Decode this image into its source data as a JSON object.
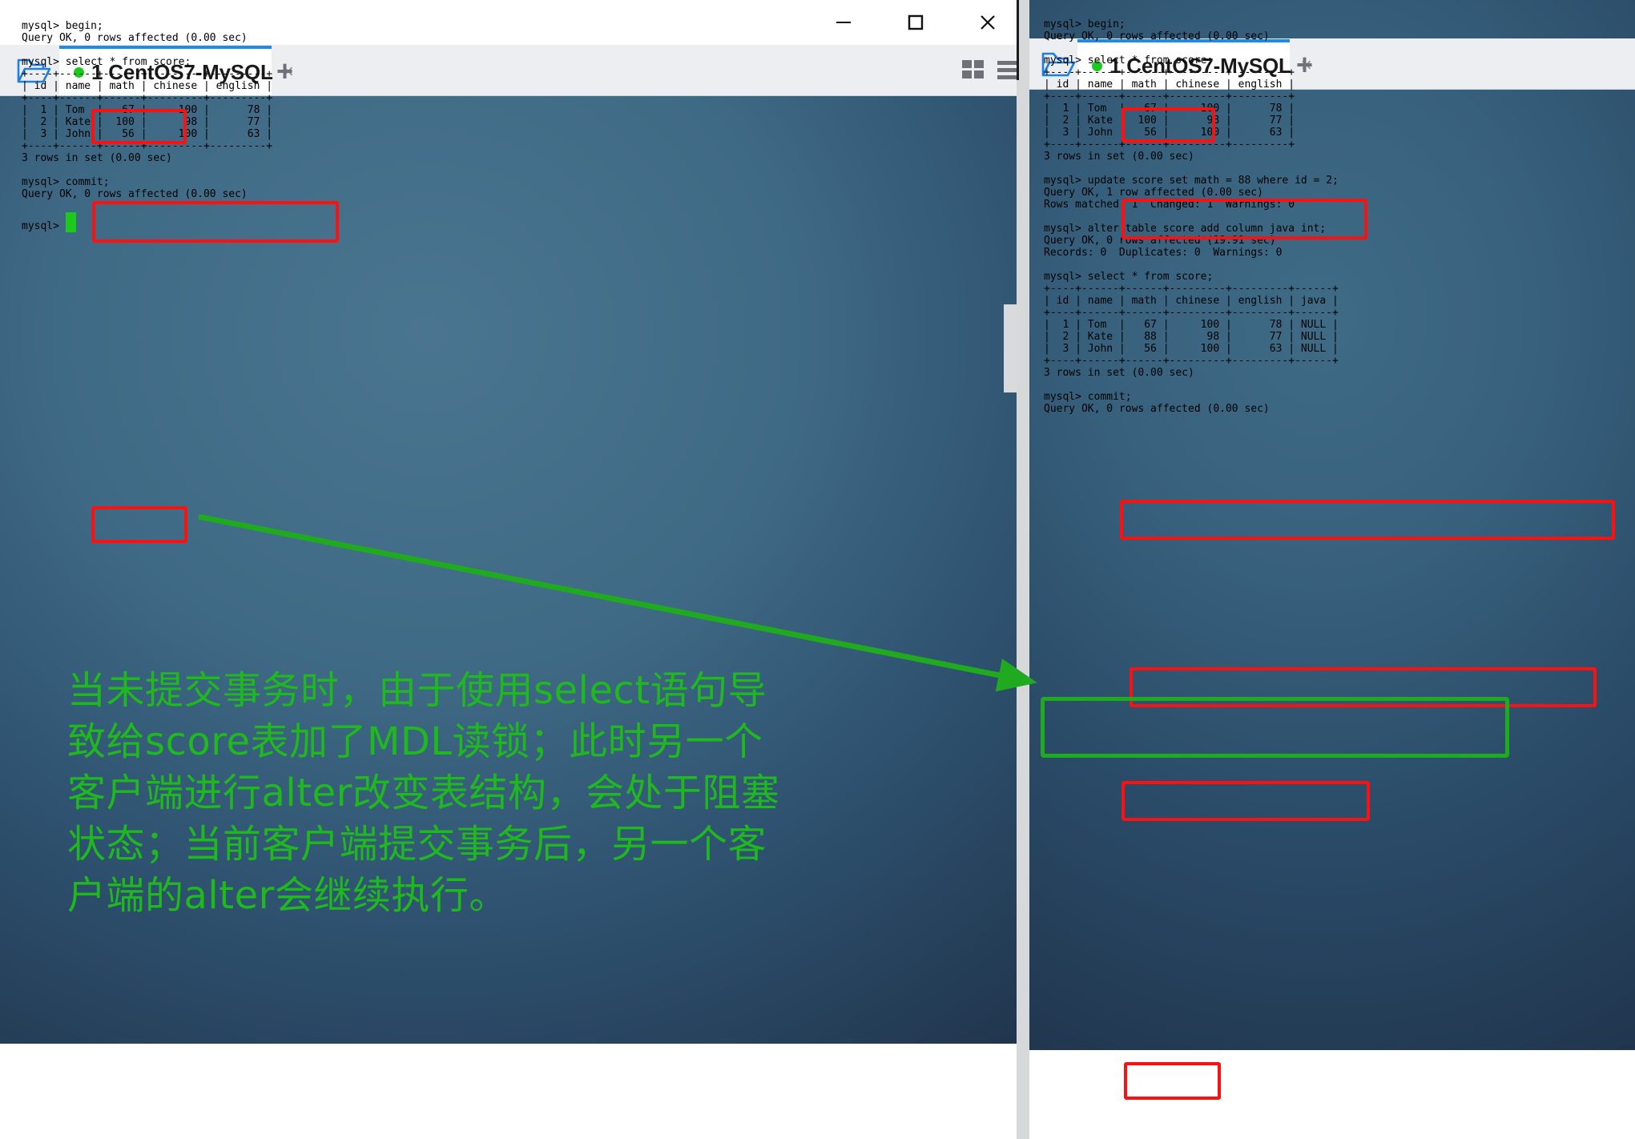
{
  "window": {
    "controls": {
      "minimize": "–",
      "maximize": "□",
      "close": "×"
    }
  },
  "left_panel": {
    "folder_icon": "open-folder-icon",
    "tab": {
      "label": "1 CentOS7-MySQL",
      "close": "×",
      "status_dot_color": "#1ec91e"
    },
    "new_tab_button": "+",
    "toolbar": {
      "grid_view": "grid-view-icon",
      "list_view": "list-view-icon"
    },
    "terminal_text": "mysql> begin;\nQuery OK, 0 rows affected (0.00 sec)\n\nmysql> select * from score;\n+----+------+------+---------+---------+\n| id | name | math | chinese | english |\n+----+------+------+---------+---------+\n|  1 | Tom  |   67 |     100 |      78 |\n|  2 | Kate |  100 |      98 |      77 |\n|  3 | John |   56 |     100 |      63 |\n+----+------+------+---------+---------+\n3 rows in set (0.00 sec)\n\nmysql> commit;\nQuery OK, 0 rows affected (0.00 sec)\n\nmysql> ",
    "highlighted_commands": [
      "begin;",
      "select * from score;",
      "commit;"
    ]
  },
  "right_panel": {
    "folder_icon": "open-folder-icon",
    "tab": {
      "label": "1 CentOS7-MySQL",
      "close": "×",
      "status_dot_color": "#1ec91e"
    },
    "new_tab_button": "+",
    "terminal_text": "mysql> begin;\nQuery OK, 0 rows affected (0.00 sec)\n\nmysql> select * from score;\n+----+------+------+---------+---------+\n| id | name | math | chinese | english |\n+----+------+------+---------+---------+\n|  1 | Tom  |   67 |     100 |      78 |\n|  2 | Kate |  100 |      98 |      77 |\n|  3 | John |   56 |     100 |      63 |\n+----+------+------+---------+---------+\n3 rows in set (0.00 sec)\n\nmysql> update score set math = 88 where id = 2;\nQuery OK, 1 row affected (0.00 sec)\nRows matched: 1  Changed: 1  Warnings: 0\n\nmysql> alter table score add column java int;\nQuery OK, 0 rows affected (19.91 sec)\nRecords: 0  Duplicates: 0  Warnings: 0\n\nmysql> select * from score;\n+----+------+------+---------+---------+------+\n| id | name | math | chinese | english | java |\n+----+------+------+---------+---------+------+\n|  1 | Tom  |   67 |     100 |      78 | NULL |\n|  2 | Kate |   88 |      98 |      77 | NULL |\n|  3 | John |   56 |     100 |      63 | NULL |\n+----+------+------+---------+---------+------+\n3 rows in set (0.00 sec)\n\nmysql> commit;\nQuery OK, 0 rows affected (0.00 sec)",
    "highlighted_commands": [
      "begin;",
      "select * from score;",
      "update score set math = 88 where id = 2;",
      "alter table score add column java int;",
      "select * from score;",
      "commit;"
    ],
    "green_highlight": "Query OK, 0 rows affected (19.91 sec)\nRecords: 0  Duplicates: 0  Warnings: 0"
  },
  "annotation": {
    "text": "当未提交事务时，由于使用select语句导致给score表加了MDL读锁；此时另一个客户端进行alter改变表结构，会处于阻塞状态；当前客户端提交事务后，另一个客户端的alter会继续执行。",
    "lines": [
      "当未提交事务时，由于使用select语句",
      "导致给score表加了MDL读锁；此时另",
      "一个客户端进行alter改变表结构，会处",
      "于阻塞状态；当前客户端提交事务后，",
      "另一个客户端的alter会继续执行。"
    ],
    "color": "#1fb81f",
    "arrow": "green-arrow-icon"
  },
  "tables": {
    "before": {
      "columns": [
        "id",
        "name",
        "math",
        "chinese",
        "english"
      ],
      "rows": [
        [
          "1",
          "Tom",
          "67",
          "100",
          "78"
        ],
        [
          "2",
          "Kate",
          "100",
          "98",
          "77"
        ],
        [
          "3",
          "John",
          "56",
          "100",
          "63"
        ]
      ],
      "row_count": "3 rows in set (0.00 sec)"
    },
    "after": {
      "columns": [
        "id",
        "name",
        "math",
        "chinese",
        "english",
        "java"
      ],
      "rows": [
        [
          "1",
          "Tom",
          "67",
          "100",
          "78",
          "NULL"
        ],
        [
          "2",
          "Kate",
          "88",
          "98",
          "77",
          "NULL"
        ],
        [
          "3",
          "John",
          "56",
          "100",
          "63",
          "NULL"
        ]
      ],
      "row_count": "3 rows in set (0.00 sec)"
    }
  }
}
